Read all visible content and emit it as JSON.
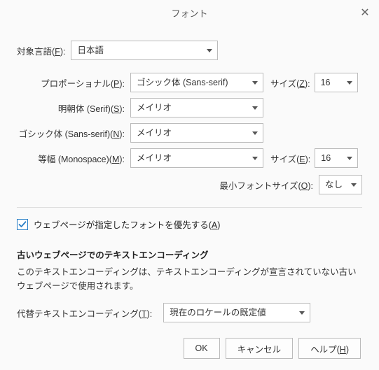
{
  "title": "フォント",
  "labels": {
    "language": "対象言語(F):",
    "proportional": "プロポーショナル(P):",
    "serif": "明朝体 (Serif)(S):",
    "sans": "ゴシック体 (Sans-serif)(N):",
    "mono": "等幅 (Monospace)(M):",
    "sizeZ": "サイズ(Z):",
    "sizeE": "サイズ(E):",
    "minfont": "最小フォントサイズ(O):",
    "fallback": "代替テキストエンコーディング(T):"
  },
  "values": {
    "language": "日本語",
    "proportional": "ゴシック体 (Sans-serif)",
    "serif": "メイリオ",
    "sans": "メイリオ",
    "mono": "メイリオ",
    "sizeZ": "16",
    "sizeE": "16",
    "minfont": "なし",
    "fallback": "現在のロケールの既定値"
  },
  "checkbox": {
    "label": "ウェブページが指定したフォントを優先する(A)",
    "checked": true
  },
  "encoding": {
    "heading": "古いウェブページでのテキストエンコーディング",
    "desc": "このテキストエンコーディングは、テキストエンコーディングが宣言されていない古いウェブページで使用されます。"
  },
  "buttons": {
    "ok": "OK",
    "cancel": "キャンセル",
    "help": "ヘルプ(H)"
  }
}
